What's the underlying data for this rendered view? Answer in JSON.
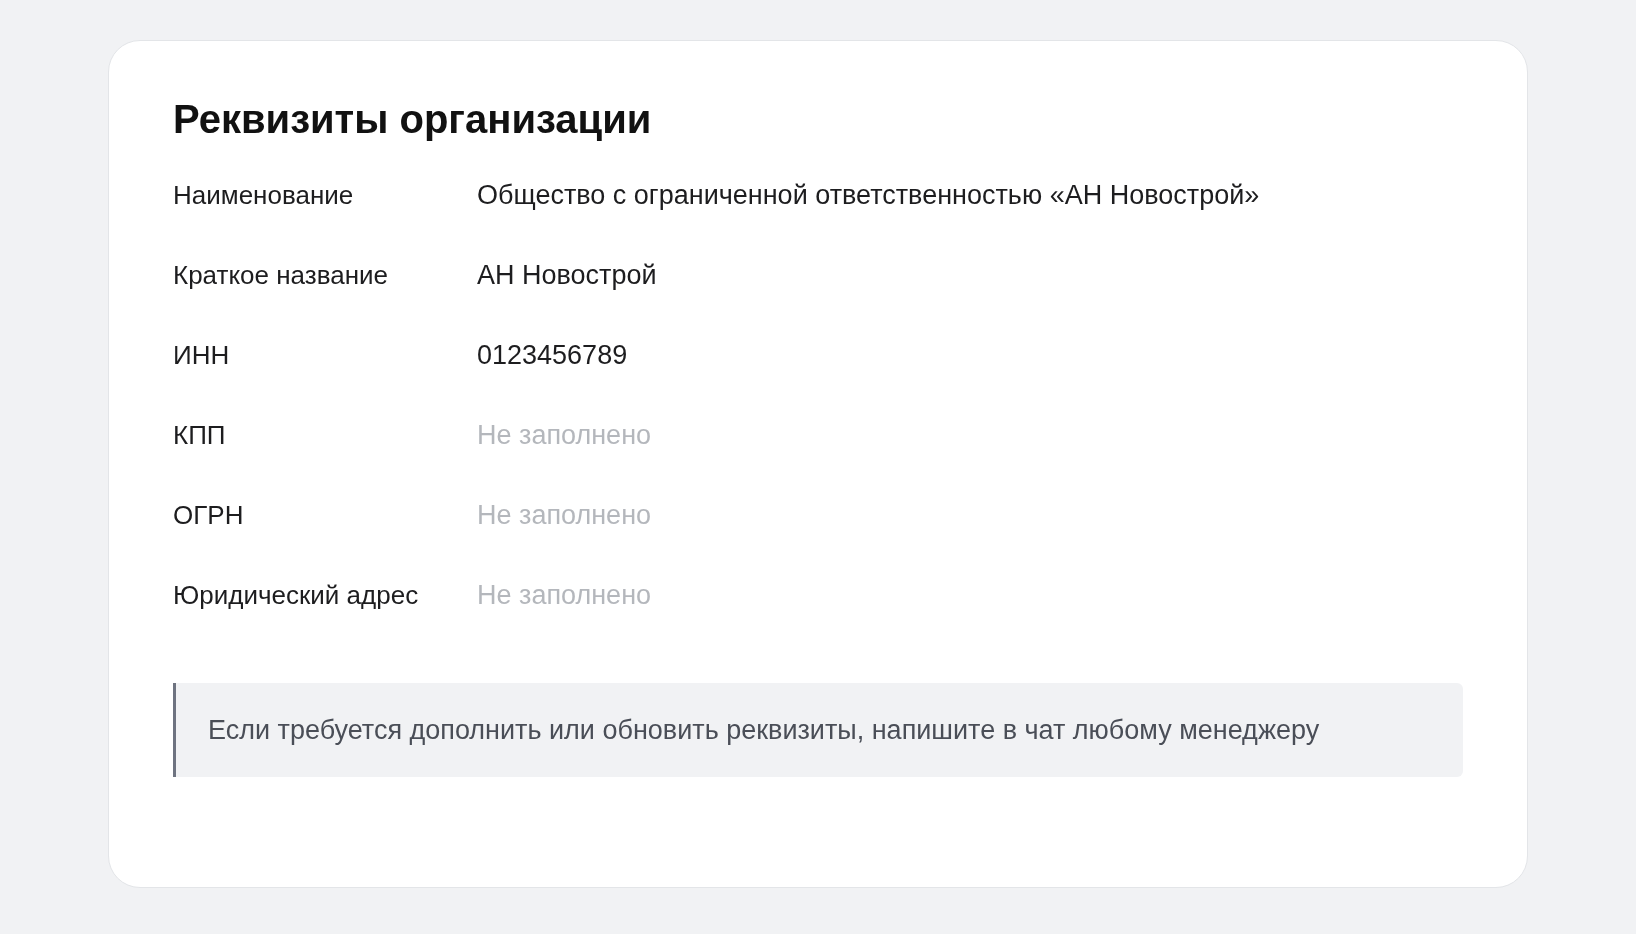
{
  "card": {
    "title": "Реквизиты организации",
    "rows": [
      {
        "label": "Наименование",
        "value": "Общество с ограниченной ответственностью «АН Новострой»",
        "empty": false
      },
      {
        "label": "Краткое название",
        "value": "АН Новострой",
        "empty": false
      },
      {
        "label": "ИНН",
        "value": "0123456789",
        "empty": false
      },
      {
        "label": "КПП",
        "value": "Не заполнено",
        "empty": true
      },
      {
        "label": "ОГРН",
        "value": "Не заполнено",
        "empty": true
      },
      {
        "label": "Юридический адрес",
        "value": "Не заполнено",
        "empty": true
      }
    ],
    "note": "Если требуется дополнить или обновить реквизиты, напишите в чат любому менеджеру"
  }
}
